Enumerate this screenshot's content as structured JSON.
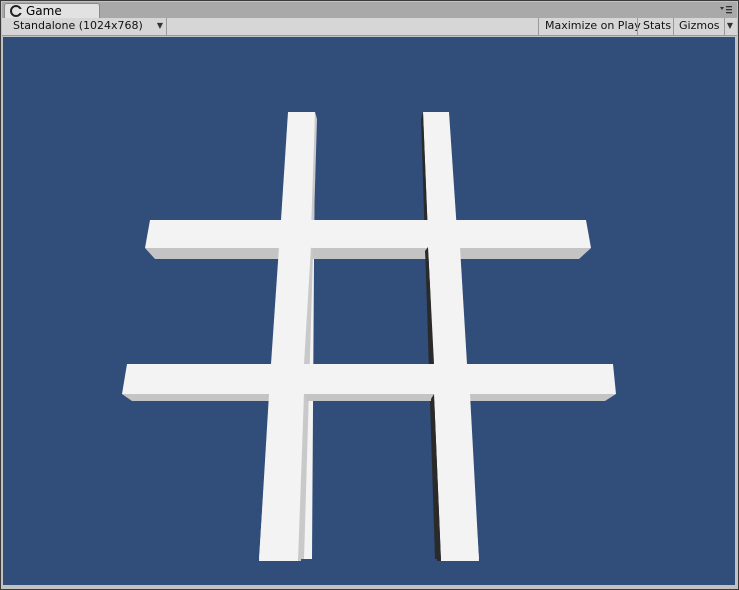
{
  "tab": {
    "title": "Game"
  },
  "toolbar": {
    "resolution": "Standalone (1024x768)",
    "maximize_label": "Maximize on Play",
    "stats_label": "Stats",
    "gizmos_label": "Gizmos"
  },
  "icons": {
    "tab_icon": "unity-game-icon",
    "dropdown": "dropdown-arrow-icon",
    "tab_menu": "tab-menu-icon"
  },
  "colors": {
    "scene_background": "#314d7a",
    "board_bars": "#f3f3f3"
  }
}
